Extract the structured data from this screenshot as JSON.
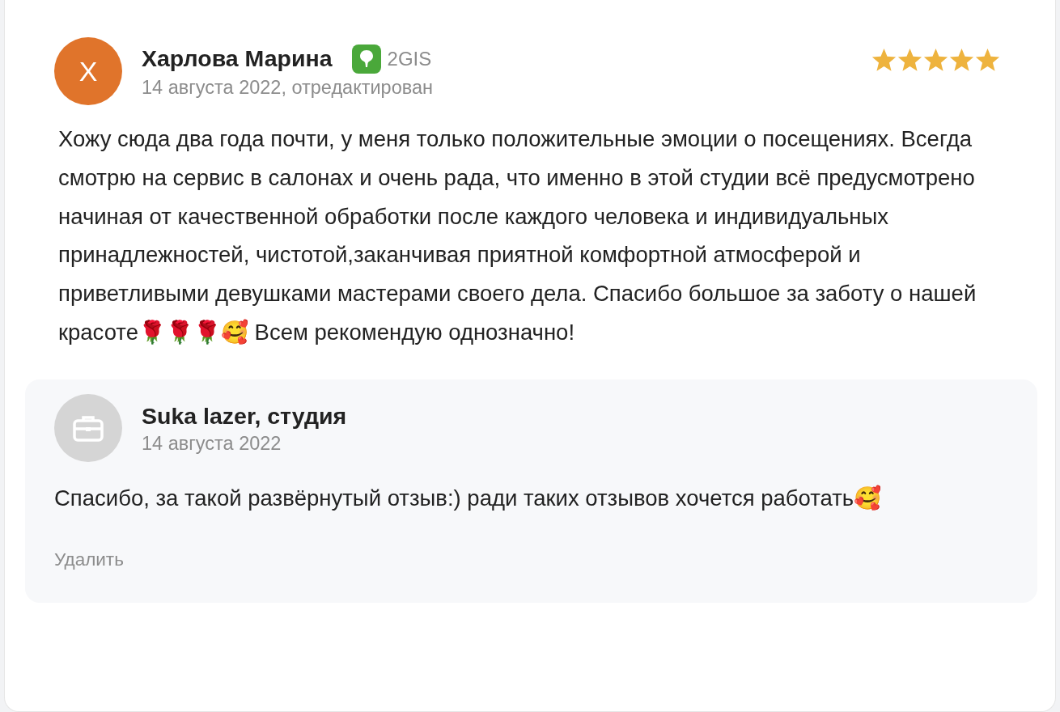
{
  "review": {
    "avatar_letter": "Х",
    "author": "Харлова Марина",
    "source": "2GIS",
    "date": "14 августа 2022, отредактирован",
    "stars": 5,
    "text": "Хожу сюда два года почти, у меня только положительные эмоции о посещениях. Всегда смотрю на сервис в салонах и очень рада, что именно в этой студии всё предусмотрено начиная от качественной обработки после каждого человека и индивидуальных принадлежностей, чистотой,заканчивая приятной комфортной атмосферой и приветливыми девушками мастерами своего дела. Спасибо большое за заботу о нашей красоте🌹🌹🌹🥰 Всем рекомендую однозначно!"
  },
  "reply": {
    "author": "Suka lazer, студия",
    "date": "14 августа 2022",
    "text": "Спасибо, за такой развёрнутый отзыв:) ради таких отзывов хочется работать🥰",
    "delete_link": "Удалить"
  }
}
